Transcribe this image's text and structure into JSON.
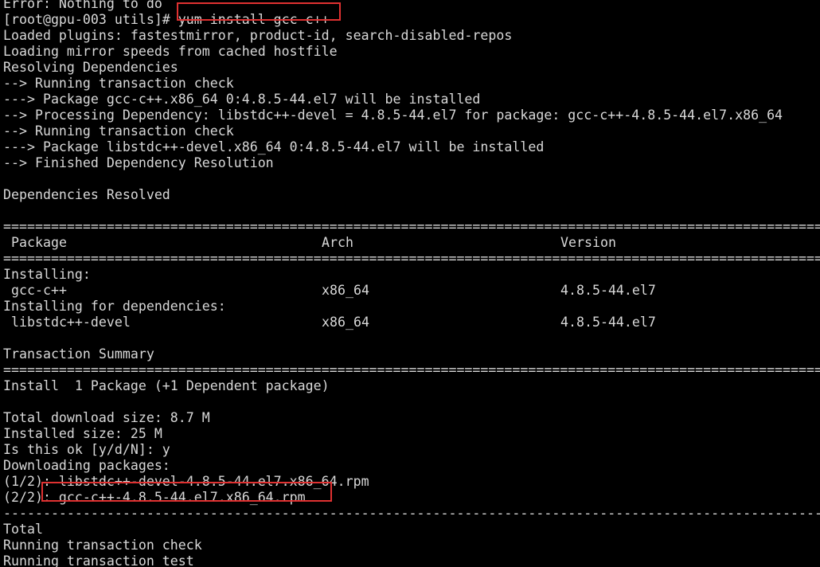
{
  "terminal": {
    "line_01": "Error: Nothing to do",
    "prompt": "[root@gpu-003 utils]# ",
    "command": "yum install gcc-c++",
    "line_03": "Loaded plugins: fastestmirror, product-id, search-disabled-repos",
    "line_04": "Loading mirror speeds from cached hostfile",
    "line_05": "Resolving Dependencies",
    "line_06": "--> Running transaction check",
    "line_07": "---> Package gcc-c++.x86_64 0:4.8.5-44.el7 will be installed",
    "line_08": "--> Processing Dependency: libstdc++-devel = 4.8.5-44.el7 for package: gcc-c++-4.8.5-44.el7.x86_64",
    "line_09": "--> Running transaction check",
    "line_10": "---> Package libstdc++-devel.x86_64 0:4.8.5-44.el7 will be installed",
    "line_11": "--> Finished Dependency Resolution",
    "line_13": "Dependencies Resolved",
    "double_rule": "=============================================================================================================================================================================",
    "single_rule": "-------------------------------------------------------------------------------------------------------------------------------------------------------------------------------",
    "table": {
      "headers": {
        "package": "Package",
        "arch": "Arch",
        "version": "Version"
      },
      "installing_label": "Installing:",
      "deps_label": "Installing for dependencies:",
      "rows": [
        {
          "package": "gcc-c++",
          "arch": "x86_64",
          "version": "4.8.5-44.el7"
        },
        {
          "package": "libstdc++-devel",
          "arch": "x86_64",
          "version": "4.8.5-44.el7"
        }
      ]
    },
    "line_23": "Transaction Summary",
    "line_25": "Install  1 Package (+1 Dependent package)",
    "line_27": "Total download size: 8.7 M",
    "line_28": "Installed size: 25 M",
    "line_29": "Is this ok [y/d/N]: y",
    "line_30": "Downloading packages:",
    "line_31": "(1/2): libstdc++-devel-4.8.5-44.el7.x86_64.rpm",
    "line_32_prefix": "(2/2)",
    "line_32_file": ": gcc-c++-4.8.5-44.el7.x86_64.rpm",
    "line_34": "Total",
    "line_35": "Running transaction check",
    "line_36": "Running transaction test"
  },
  "colors": {
    "background": "#000000",
    "text": "#d8d8d8",
    "highlight_box": "#e03131"
  }
}
